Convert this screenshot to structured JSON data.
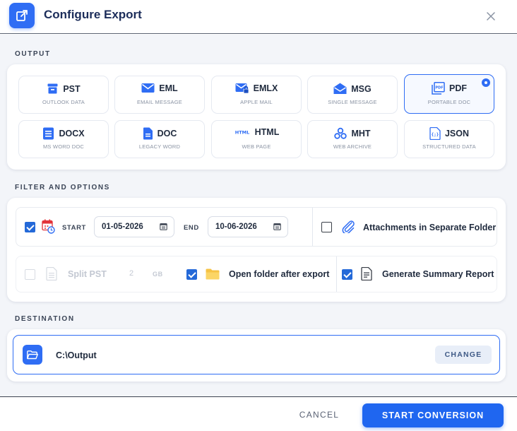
{
  "dialog": {
    "title": "Configure Export",
    "accent_color": "#2f6df4"
  },
  "sections": {
    "output": "OUTPUT",
    "filter": "FILTER AND OPTIONS",
    "destination": "DESTINATION"
  },
  "formats": [
    {
      "name": "PST",
      "sub": "OUTLOOK DATA",
      "icon": "archive-icon",
      "selected": false
    },
    {
      "name": "EML",
      "sub": "EMAIL MESSAGE",
      "icon": "envelope-icon",
      "selected": false
    },
    {
      "name": "EMLX",
      "sub": "APPLE MAIL",
      "icon": "envelope-lock-icon",
      "selected": false
    },
    {
      "name": "MSG",
      "sub": "SINGLE MESSAGE",
      "icon": "envelope-open-icon",
      "selected": false
    },
    {
      "name": "PDF",
      "sub": "PORTABLE DOC",
      "icon": "pdf-icon",
      "selected": true
    },
    {
      "name": "DOCX",
      "sub": "MS WORD DOC",
      "icon": "docx-icon",
      "selected": false
    },
    {
      "name": "DOC",
      "sub": "LEGACY WORD",
      "icon": "doc-icon",
      "selected": false
    },
    {
      "name": "HTML",
      "sub": "WEB PAGE",
      "icon": "html-icon",
      "selected": false
    },
    {
      "name": "MHT",
      "sub": "WEB ARCHIVE",
      "icon": "mht-icon",
      "selected": false
    },
    {
      "name": "JSON",
      "sub": "STRUCTURED DATA",
      "icon": "json-icon",
      "selected": false
    }
  ],
  "filter": {
    "date_enabled": true,
    "start_label": "START",
    "start_date": "01-05-2026",
    "end_label": "END",
    "end_date": "10-06-2026",
    "attachments_label": "Attachments in Separate Folder",
    "attachments_checked": false,
    "split_label": "Split PST",
    "split_value": "2",
    "split_unit": "GB",
    "split_enabled": false,
    "open_folder_label": "Open folder after export",
    "open_folder_checked": true,
    "summary_label": "Generate Summary Report",
    "summary_checked": true
  },
  "destination": {
    "path": "C:\\Output",
    "change_label": "CHANGE"
  },
  "footer": {
    "cancel_label": "CANCEL",
    "start_label": "START CONVERSION"
  }
}
